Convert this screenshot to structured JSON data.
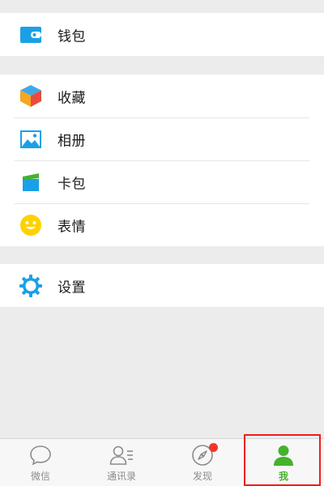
{
  "groups": {
    "wallet": [
      {
        "label": "钱包",
        "icon": "wallet-icon"
      }
    ],
    "features": [
      {
        "label": "收藏",
        "icon": "favorites-cube-icon"
      },
      {
        "label": "相册",
        "icon": "album-image-icon"
      },
      {
        "label": "卡包",
        "icon": "card-pack-icon"
      },
      {
        "label": "表情",
        "icon": "emoji-smiley-icon"
      }
    ],
    "settings": [
      {
        "label": "设置",
        "icon": "settings-gear-icon"
      }
    ]
  },
  "tabbar": {
    "tabs": [
      {
        "label": "微信",
        "icon": "chat-bubble-icon",
        "active": false
      },
      {
        "label": "通讯录",
        "icon": "contacts-icon",
        "active": false
      },
      {
        "label": "发现",
        "icon": "compass-icon",
        "active": false,
        "badge": true
      },
      {
        "label": "我",
        "icon": "person-icon",
        "active": true
      }
    ]
  },
  "colors": {
    "background": "#ececec",
    "active_tab": "#45b22c",
    "inactive_tab": "#8c8c8c",
    "badge": "#f43530",
    "highlight_box": "#ee1c1c",
    "wallet": "#1aa0e8",
    "album": "#1aa0e8",
    "emoji": "#ffd100",
    "settings": "#1aa0e8"
  }
}
